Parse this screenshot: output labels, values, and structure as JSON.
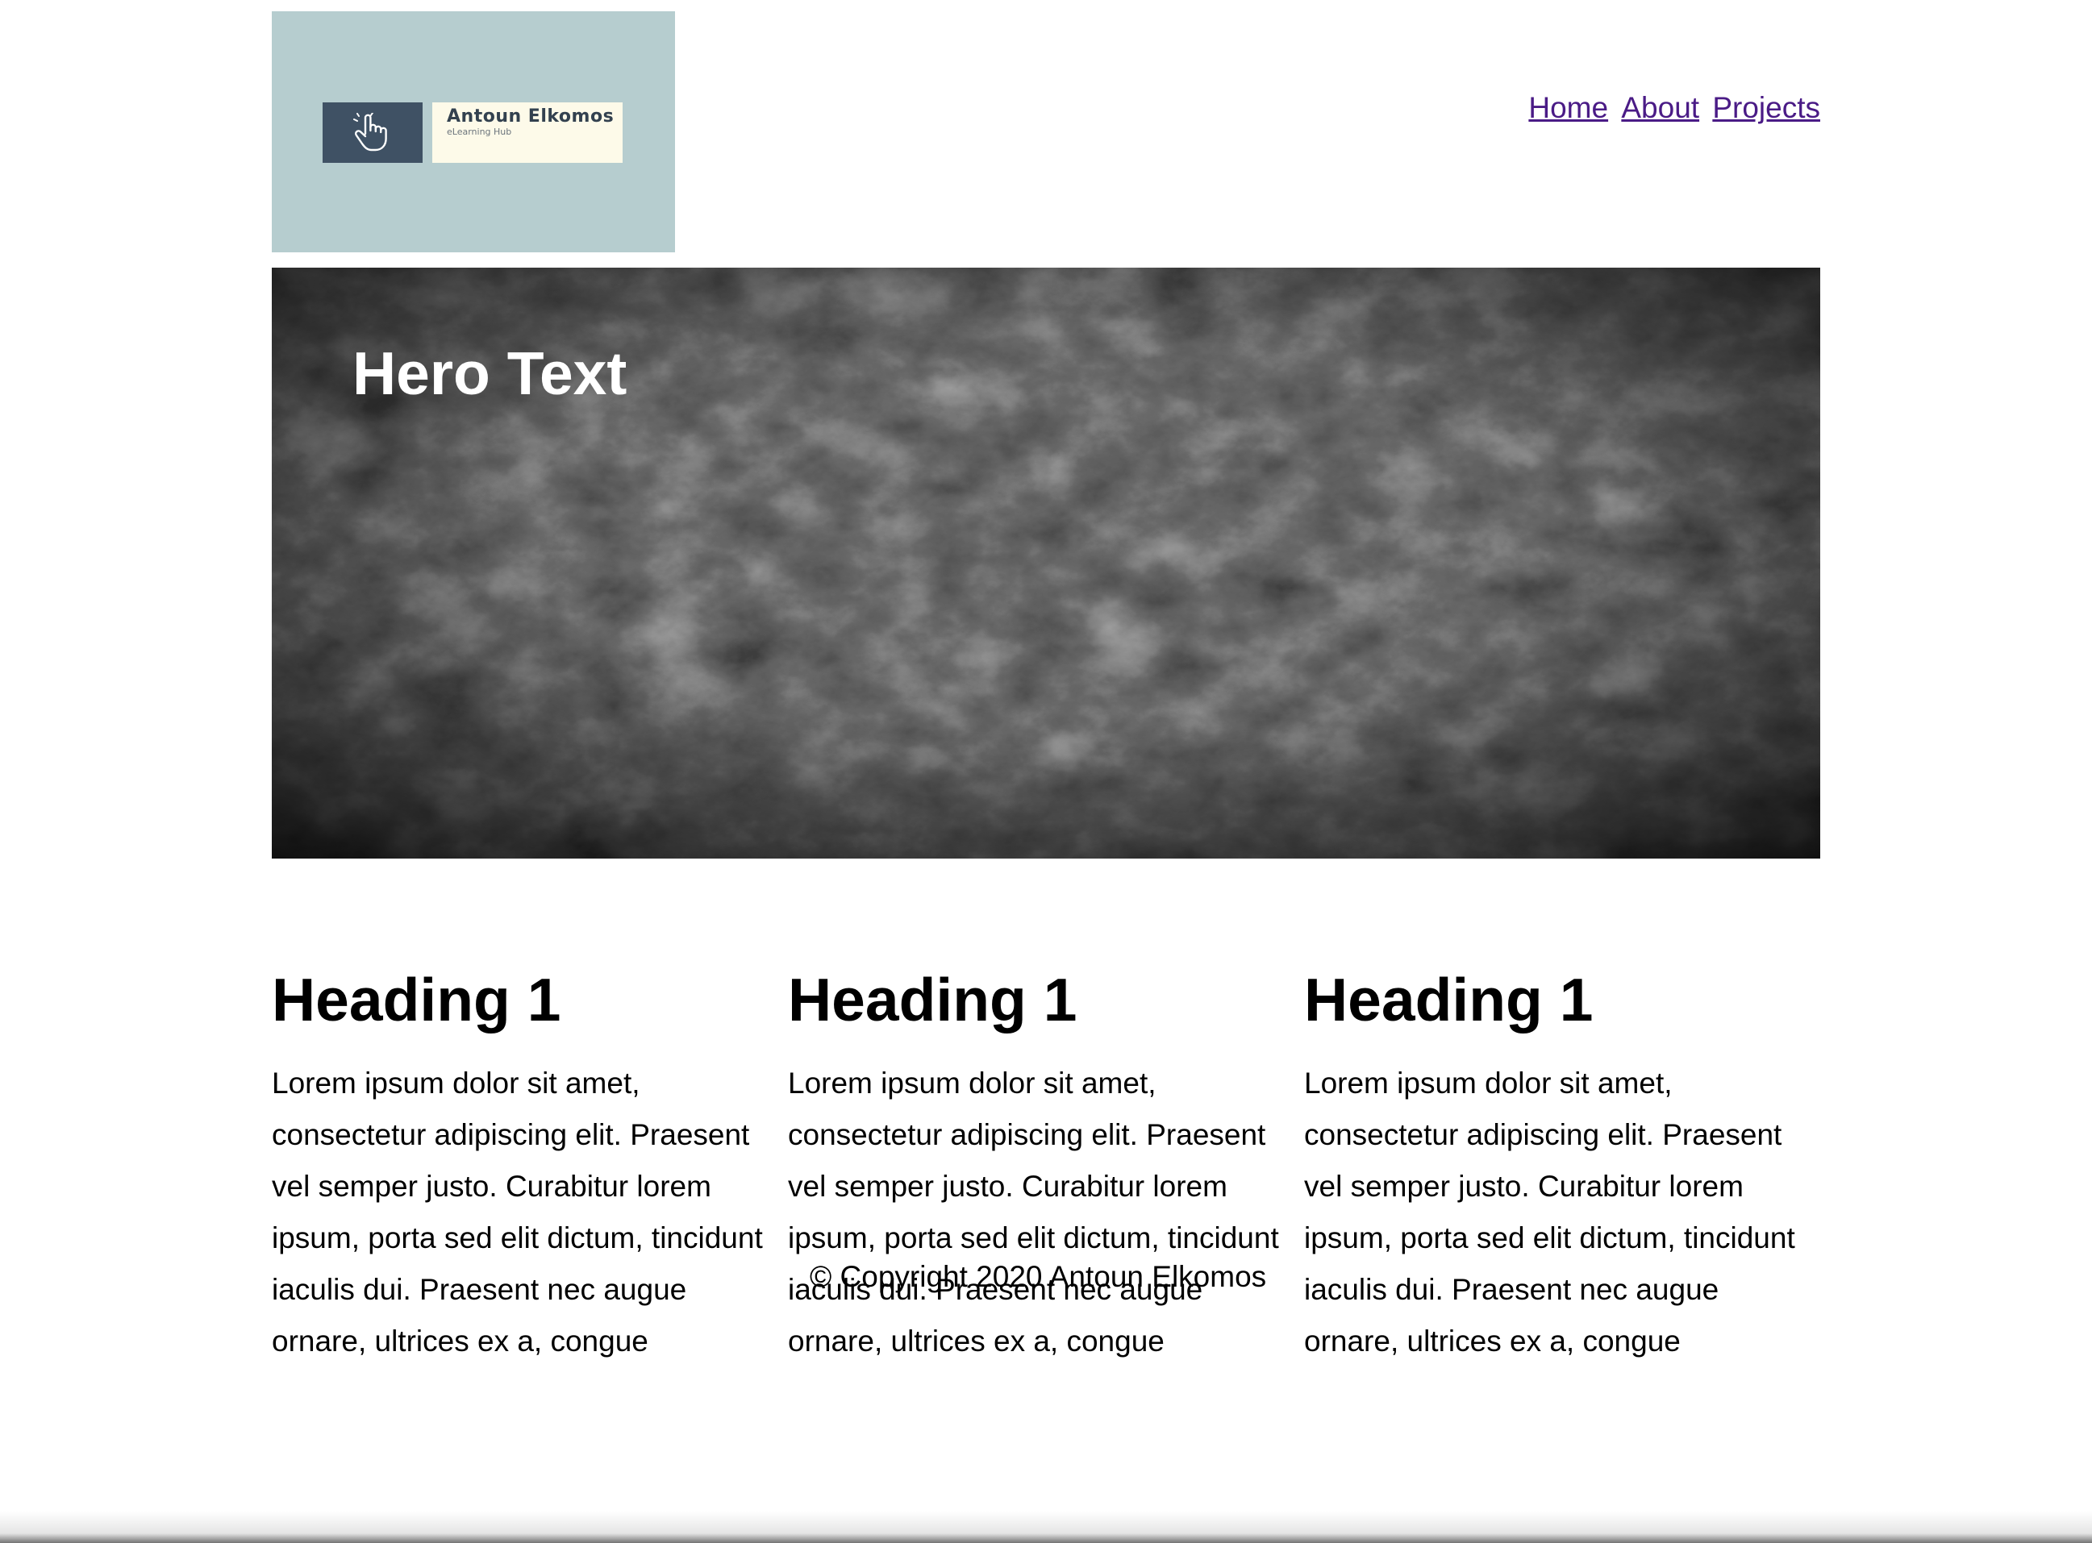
{
  "header": {
    "logo": {
      "name": "Antoun Elkomos",
      "tagline": "eLearning Hub",
      "icon": "pointing-hand-icon"
    },
    "nav": [
      {
        "label": "Home"
      },
      {
        "label": "About"
      },
      {
        "label": "Projects"
      }
    ]
  },
  "hero": {
    "text": "Hero Text"
  },
  "columns": [
    {
      "heading": "Heading 1",
      "body": "Lorem ipsum dolor sit amet, consectetur adipiscing elit. Praesent vel semper justo. Curabitur lorem ipsum, porta sed elit dictum, tincidunt iaculis dui. Praesent nec augue ornare, ultrices ex a, congue"
    },
    {
      "heading": "Heading 1",
      "body": "Lorem ipsum dolor sit amet, consectetur adipiscing elit. Praesent vel semper justo. Curabitur lorem ipsum, porta sed elit dictum, tincidunt iaculis dui. Praesent nec augue ornare, ultrices ex a, congue"
    },
    {
      "heading": "Heading 1",
      "body": "Lorem ipsum dolor sit amet, consectetur adipiscing elit. Praesent vel semper justo. Curabitur lorem ipsum, porta sed elit dictum, tincidunt iaculis dui. Praesent nec augue ornare, ultrices ex a, congue"
    }
  ],
  "footer": {
    "copyright": "© Copyright 2020 Antoun Elkomos"
  },
  "colors": {
    "logo_background": "#b6cdcf",
    "logo_mark": "#3f5164",
    "logo_wordmark_background": "#fdfae9",
    "link": "#4a1b86",
    "hero_background": "#151515"
  }
}
